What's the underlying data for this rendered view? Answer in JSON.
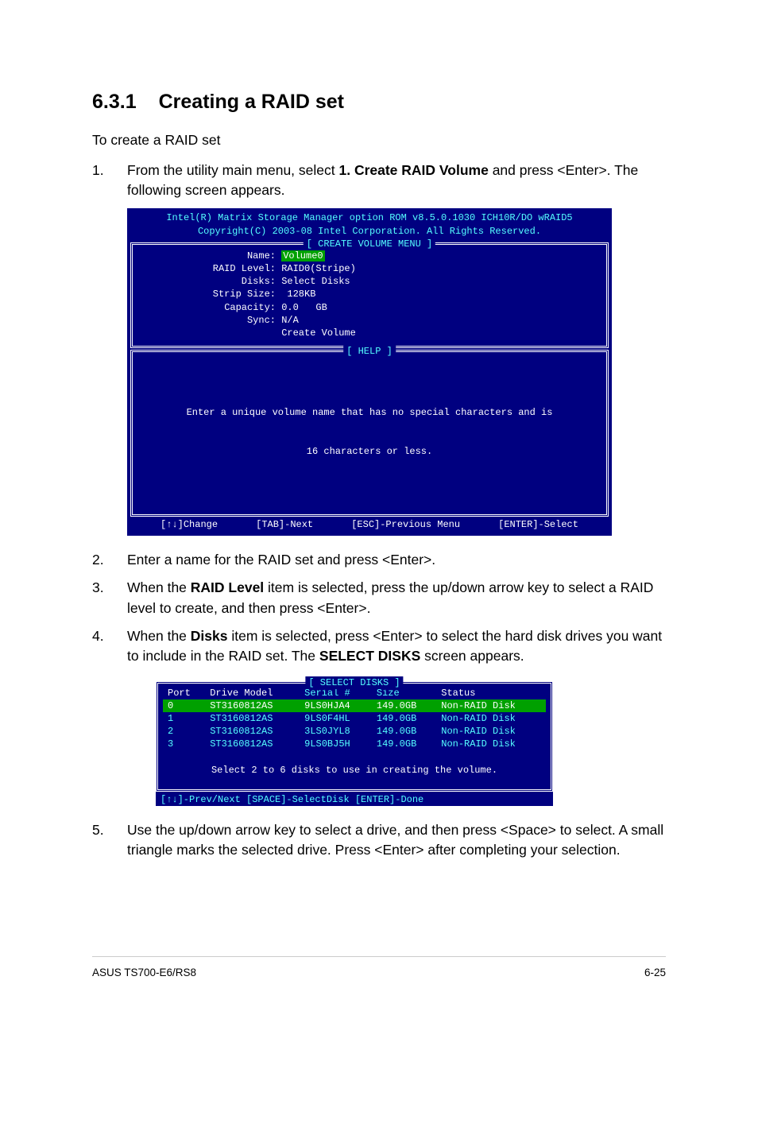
{
  "heading": {
    "number": "6.3.1",
    "title": "Creating a RAID set"
  },
  "intro": "To create a RAID set",
  "steps": [
    {
      "n": "1.",
      "pre": "From the utility main menu, select ",
      "bold": "1. Create RAID Volume",
      "post": " and press <Enter>. The following screen appears."
    },
    {
      "n": "2.",
      "text": "Enter a name for the RAID set and press <Enter>."
    },
    {
      "n": "3.",
      "pre": "When the ",
      "bold": "RAID Level",
      "post": " item is selected, press the up/down arrow key to select a RAID level to create, and then press <Enter>."
    },
    {
      "n": "4.",
      "pre": "When the ",
      "bold": "Disks",
      "post": " item is selected, press <Enter> to select the hard disk drives you want to include in the RAID set. The ",
      "bold2": "SELECT DISKS",
      "post2": " screen appears."
    },
    {
      "n": "5.",
      "text": "Use the up/down arrow key to select a drive, and then press <Space> to select. A small triangle marks the selected drive. Press <Enter> after completing your selection."
    }
  ],
  "bios1": {
    "title1": "Intel(R) Matrix Storage Manager option ROM v8.5.0.1030 ICH10R/DO wRAID5",
    "title2": "Copyright(C) 2003-08 Intel Corporation.  All Rights Reserved.",
    "box1_label": "[ CREATE VOLUME MENU ]",
    "fields": [
      {
        "k": "Name:",
        "v": "Volume0",
        "hl": true
      },
      {
        "k": "RAID Level:",
        "v": "RAID0(Stripe)"
      },
      {
        "k": "Disks:",
        "v": "Select Disks"
      },
      {
        "k": "Strip Size:",
        "v": " 128KB"
      },
      {
        "k": "Capacity:",
        "v": "0.0   GB"
      },
      {
        "k": "Sync:",
        "v": "N/A"
      },
      {
        "k": "",
        "v": "Create Volume"
      }
    ],
    "box2_label": "[ HELP ]",
    "help1": "Enter a unique volume name that has no special characters and is",
    "help2": "16 characters or less.",
    "footer": [
      "[↑↓]Change",
      "[TAB]-Next",
      "[ESC]-Previous Menu",
      "[ENTER]-Select"
    ]
  },
  "bios2": {
    "label": "[ SELECT DISKS ]",
    "header": [
      "Port",
      "Drive Model",
      "Serial #",
      "Size",
      "Status"
    ],
    "rows": [
      {
        "sel": true,
        "c": [
          "0",
          "ST3160812AS",
          "9LS0HJA4",
          "149.0GB",
          "Non-RAID Disk"
        ]
      },
      {
        "sel": false,
        "c": [
          "1",
          "ST3160812AS",
          "9LS0F4HL",
          "149.0GB",
          "Non-RAID Disk"
        ]
      },
      {
        "sel": false,
        "c": [
          "2",
          "ST3160812AS",
          "3LS0JYL8",
          "149.0GB",
          "Non-RAID Disk"
        ]
      },
      {
        "sel": false,
        "c": [
          "3",
          "ST3160812AS",
          "9LS0BJ5H",
          "149.0GB",
          "Non-RAID Disk"
        ]
      }
    ],
    "msg": "Select 2 to 6 disks to use in creating the volume.",
    "footer": "[↑↓]-Prev/Next [SPACE]-SelectDisk [ENTER]-Done"
  },
  "footer": {
    "left": "ASUS TS700-E6/RS8",
    "right": "6-25"
  }
}
